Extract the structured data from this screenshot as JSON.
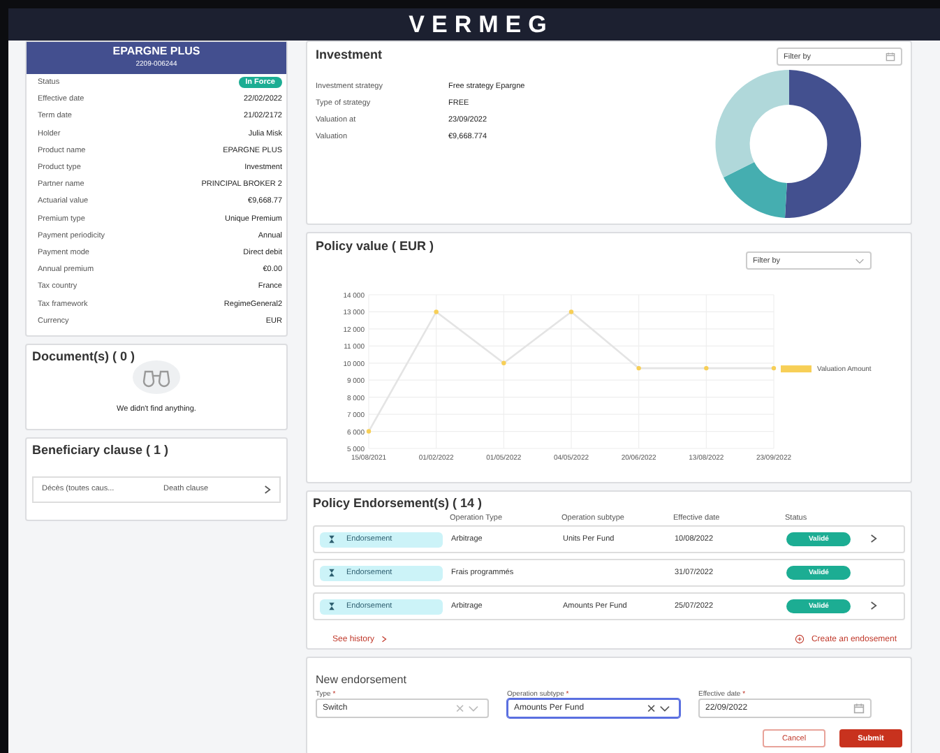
{
  "header": {
    "logo": "VERMEG"
  },
  "policy": {
    "name": "EPARGNE PLUS",
    "number": "2209-006244",
    "fields": [
      {
        "label": "Status",
        "value": "In Force",
        "kind": "badge"
      },
      {
        "label": "Effective date",
        "value": "22/02/2022",
        "kind": "text"
      },
      {
        "label": "Term date",
        "value": "21/02/2172",
        "kind": "text"
      },
      {
        "label": "Holder",
        "value": "Julia Misk",
        "kind": "text"
      },
      {
        "label": "Product name",
        "value": "EPARGNE PLUS",
        "kind": "text"
      },
      {
        "label": "Product type",
        "value": "Investment",
        "kind": "text"
      },
      {
        "label": "Partner name",
        "value": "PRINCIPAL BROKER 2",
        "kind": "text"
      },
      {
        "label": "Actuarial value",
        "value": "€9,668.77",
        "kind": "text"
      },
      {
        "label": "Premium type",
        "value": "Unique Premium",
        "kind": "text"
      },
      {
        "label": "Payment periodicity",
        "value": "Annual",
        "kind": "text"
      },
      {
        "label": "Payment mode",
        "value": "Direct debit",
        "kind": "text"
      },
      {
        "label": "Annual premium",
        "value": "€0.00",
        "kind": "text"
      },
      {
        "label": "Tax country",
        "value": "France",
        "kind": "text"
      },
      {
        "label": "Tax framework",
        "value": "RegimeGeneral2",
        "kind": "text"
      },
      {
        "label": "Currency",
        "value": "EUR",
        "kind": "text"
      }
    ]
  },
  "documents": {
    "title": "Document(s) ( 0 )",
    "empty_message": "We didn't find anything."
  },
  "beneficiary": {
    "title": "Beneficiary clause ( 1 )",
    "items": [
      {
        "name": "Décès (toutes caus...",
        "type": "Death clause"
      }
    ]
  },
  "investment": {
    "title": "Investment",
    "filter": {
      "placeholder": "Filter by"
    },
    "fields": [
      {
        "label": "Investment strategy",
        "value": "Free strategy Epargne"
      },
      {
        "label": "Type of strategy",
        "value": "FREE"
      },
      {
        "label": "Valuation at",
        "value": "23/09/2022"
      },
      {
        "label": "Valuation",
        "value": "€9,668.774"
      }
    ]
  },
  "policy_value": {
    "title": "Policy value ( EUR )",
    "filter": {
      "placeholder": "Filter by"
    },
    "chart_data": {
      "type": "line",
      "categories": [
        "15/08/2021",
        "01/02/2022",
        "01/05/2022",
        "04/05/2022",
        "20/06/2022",
        "13/08/2022",
        "23/09/2022"
      ],
      "series": [
        {
          "name": "Valuation Amount",
          "color": "#f7cf57",
          "marker": true,
          "values": [
            6000,
            13000,
            10000,
            13000,
            9700,
            9700,
            9700
          ]
        }
      ],
      "grid": true,
      "ylim": [
        5000,
        14000
      ],
      "yticks": [
        {
          "value": 5000,
          "label": "5 000"
        },
        {
          "value": 6000,
          "label": "6 000"
        },
        {
          "value": 7000,
          "label": "7 000"
        },
        {
          "value": 8000,
          "label": "8 000"
        },
        {
          "value": 9000,
          "label": "9 000"
        },
        {
          "value": 10000,
          "label": "10 000"
        },
        {
          "value": 11000,
          "label": "11 000"
        },
        {
          "value": 12000,
          "label": "12 000"
        },
        {
          "value": 13000,
          "label": "13 000"
        },
        {
          "value": 14000,
          "label": "14 000"
        }
      ]
    }
  },
  "endorsements": {
    "title": "Policy Endorsement(s) ( 14 )",
    "columns": [
      "Operation Type",
      "Operation subtype",
      "Effective date",
      "Status"
    ],
    "rows": [
      {
        "tag": "Endorsement",
        "operation_type": "Arbitrage",
        "operation_subtype": "Units Per Fund",
        "effective_date": "10/08/2022",
        "status": "Validé",
        "has_details": true
      },
      {
        "tag": "Endorsement",
        "operation_type": "Frais programmés",
        "operation_subtype": "",
        "effective_date": "31/07/2022",
        "status": "Validé",
        "has_details": false
      },
      {
        "tag": "Endorsement",
        "operation_type": "Arbitrage",
        "operation_subtype": "Amounts Per Fund",
        "effective_date": "25/07/2022",
        "status": "Validé",
        "has_details": true
      }
    ],
    "history_link": "See history",
    "create_link": "Create an endosement"
  },
  "new_endorsement": {
    "title": "New endorsement",
    "fields": [
      {
        "label": "Type",
        "required_mark": "*",
        "value": "Switch",
        "kind": "select",
        "focused": false
      },
      {
        "label": "Operation subtype",
        "required_mark": "*",
        "value": "Amounts Per Fund",
        "kind": "select",
        "focused": true
      },
      {
        "label": "Effective date",
        "required_mark": "*",
        "value": "22/09/2022",
        "kind": "date",
        "focused": false
      }
    ],
    "buttons": [
      {
        "label": "Cancel",
        "kind": "secondary"
      },
      {
        "label": "Submit",
        "kind": "primary"
      }
    ]
  }
}
